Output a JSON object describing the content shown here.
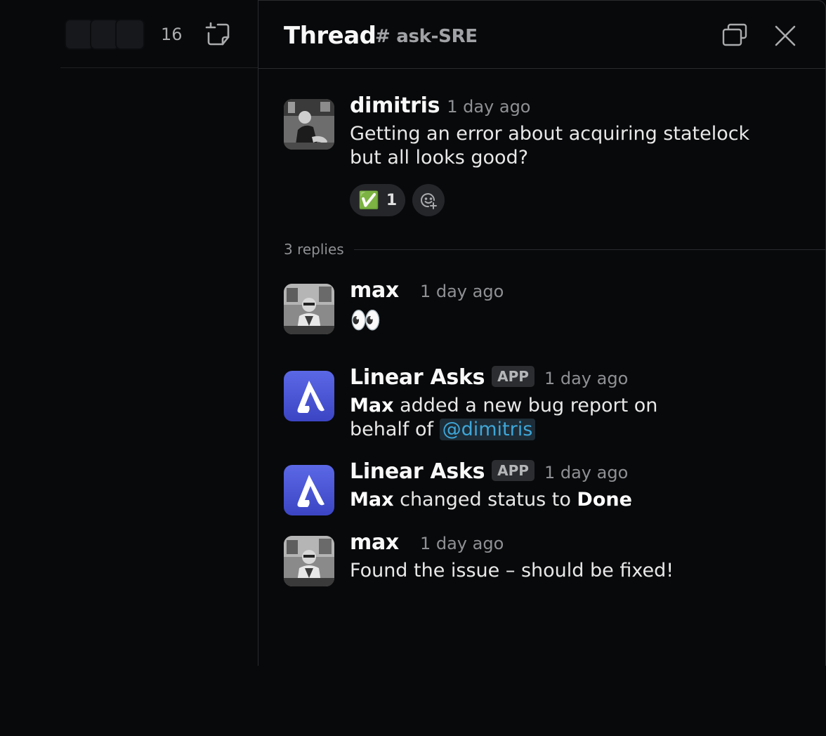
{
  "channel_header": {
    "member_count": "16"
  },
  "thread": {
    "title": "Thread",
    "channel": "# ask-SRE",
    "parent": {
      "author": "dimitris",
      "time": "1 day ago",
      "text": "Getting an error about acquiring statelock but all looks good?",
      "reaction": {
        "emoji": "✅",
        "count": "1"
      }
    },
    "replies_label": "3 replies",
    "replies": [
      {
        "author": "max",
        "time": "1 day ago",
        "emoji_text": "👀"
      },
      {
        "author": "Linear Asks",
        "badge": "APP",
        "time": "1 day ago",
        "actor": "Max",
        "text_mid": " added a new bug report on behalf of ",
        "mention": "@dimitris"
      },
      {
        "author": "Linear Asks",
        "badge": "APP",
        "time": "1 day ago",
        "actor": "Max",
        "text_mid": " changed status to ",
        "status": "Done"
      },
      {
        "author": "max",
        "time": "1 day ago",
        "text": "Found the issue – should be fixed!"
      }
    ]
  },
  "colors": {
    "background": "#08090b",
    "linear_brand": "#4a56d8",
    "mention": "#3ea6d8"
  }
}
